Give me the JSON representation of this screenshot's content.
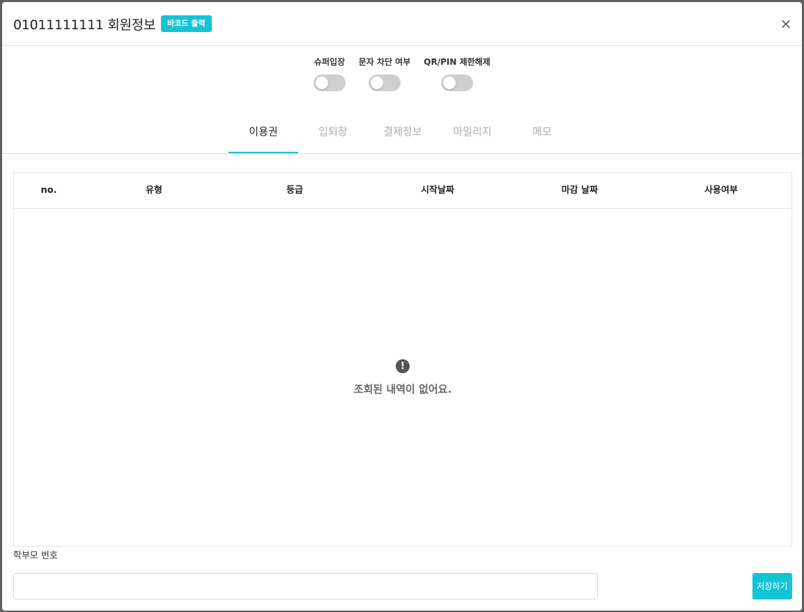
{
  "header": {
    "title": "01011111111 회원정보",
    "barcode_label": "바코드 출력",
    "close_symbol": "×"
  },
  "toggles": [
    {
      "label": "슈퍼입장",
      "on": false
    },
    {
      "label": "문자 차단 여부",
      "on": false
    },
    {
      "label": "QR/PIN 제한해제",
      "on": false
    }
  ],
  "tabs": [
    {
      "label": "이용권",
      "active": true
    },
    {
      "label": "입퇴장",
      "active": false
    },
    {
      "label": "결제정보",
      "active": false
    },
    {
      "label": "마일리지",
      "active": false
    },
    {
      "label": "메모",
      "active": false
    }
  ],
  "table": {
    "columns": [
      "no.",
      "유형",
      "등급",
      "시작날짜",
      "마감 날짜",
      "사용여부"
    ],
    "rows": [],
    "empty_icon": "!",
    "empty_text": "조회된 내역이 없어요."
  },
  "parent": {
    "label": "학부모 번호",
    "value": "",
    "placeholder": ""
  },
  "save_label": "저장하기",
  "colors": {
    "accent": "#15c3d6",
    "toggle_off": "#cfcfcf",
    "tab_inactive": "#a7adb5"
  }
}
